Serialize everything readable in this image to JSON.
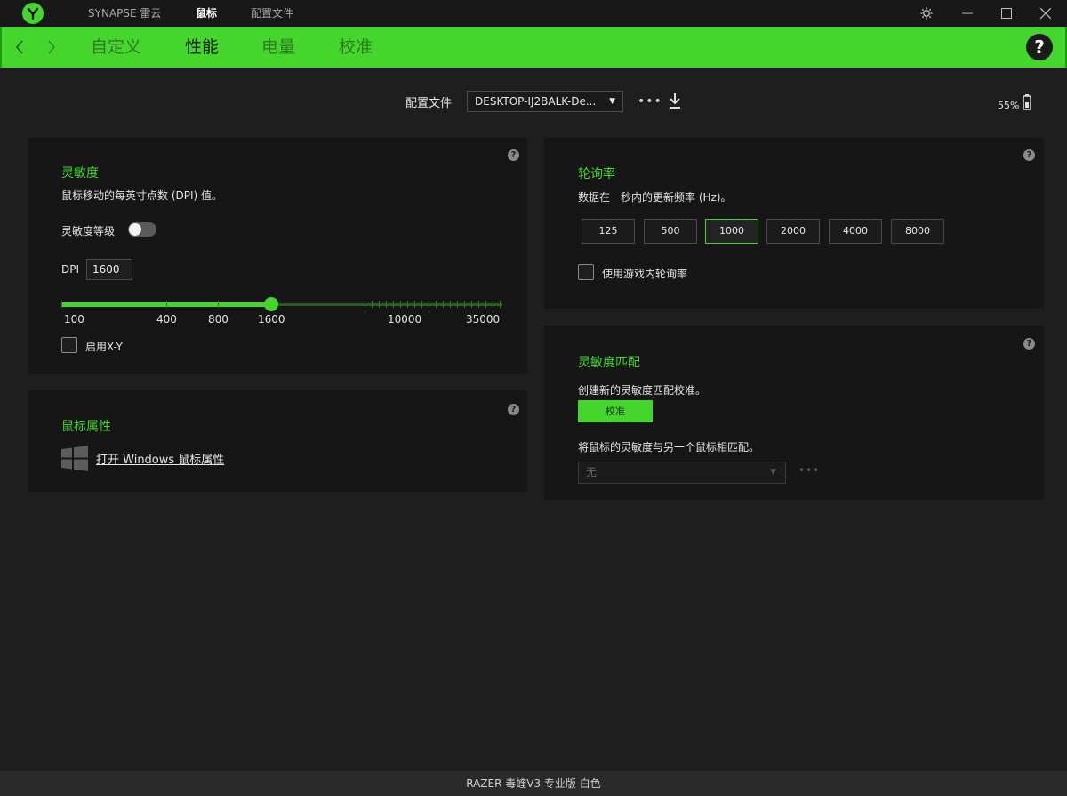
{
  "titlebar": {
    "logo": "razer-logo",
    "nav": [
      {
        "label": "SYNAPSE 雷云",
        "active": false
      },
      {
        "label": "鼠标",
        "active": true
      },
      {
        "label": "配置文件",
        "active": false
      }
    ],
    "controls": [
      "settings-icon",
      "minimize-icon",
      "maximize-icon",
      "close-icon"
    ]
  },
  "tabbar": {
    "tabs": [
      {
        "label": "自定义",
        "active": false
      },
      {
        "label": "性能",
        "active": true
      },
      {
        "label": "电量",
        "active": false
      },
      {
        "label": "校准",
        "active": false
      }
    ],
    "help": "?"
  },
  "profile": {
    "label": "配置文件",
    "value": "DESKTOP-IJ2BALK-De...",
    "more": "•••",
    "battery": "55%"
  },
  "sensitivity": {
    "title": "灵敏度",
    "desc": "鼠标移动的每英寸点数 (DPI) 值。",
    "stages_label": "灵敏度等级",
    "stages_on": false,
    "dpi_label": "DPI",
    "dpi_value": "1600",
    "slider_labels": [
      "100",
      "400",
      "800",
      "1600",
      "10000",
      "35000"
    ],
    "slider_value": 1600,
    "xy_label": "启用X-Y",
    "xy_checked": false
  },
  "mouse_props": {
    "title": "鼠标属性",
    "link": "打开 Windows 鼠标属性"
  },
  "polling": {
    "title": "轮询率",
    "desc": "数据在一秒内的更新频率 (Hz)。",
    "rates": [
      "125",
      "500",
      "1000",
      "2000",
      "4000",
      "8000"
    ],
    "selected": "1000",
    "ingame_label": "使用游戏内轮询率",
    "ingame_checked": false
  },
  "matching": {
    "title": "灵敏度匹配",
    "desc": "创建新的灵敏度匹配校准。",
    "calibrate_label": "校准",
    "match_desc": "将鼠标的灵敏度与另一个鼠标相匹配。",
    "match_value": "无",
    "more": "•••"
  },
  "footer": {
    "device": "RAZER 毒蝰V3 专业版 白色"
  },
  "colors": {
    "accent": "#44d62c",
    "panel": "#161616",
    "background": "#1e1e1e"
  }
}
